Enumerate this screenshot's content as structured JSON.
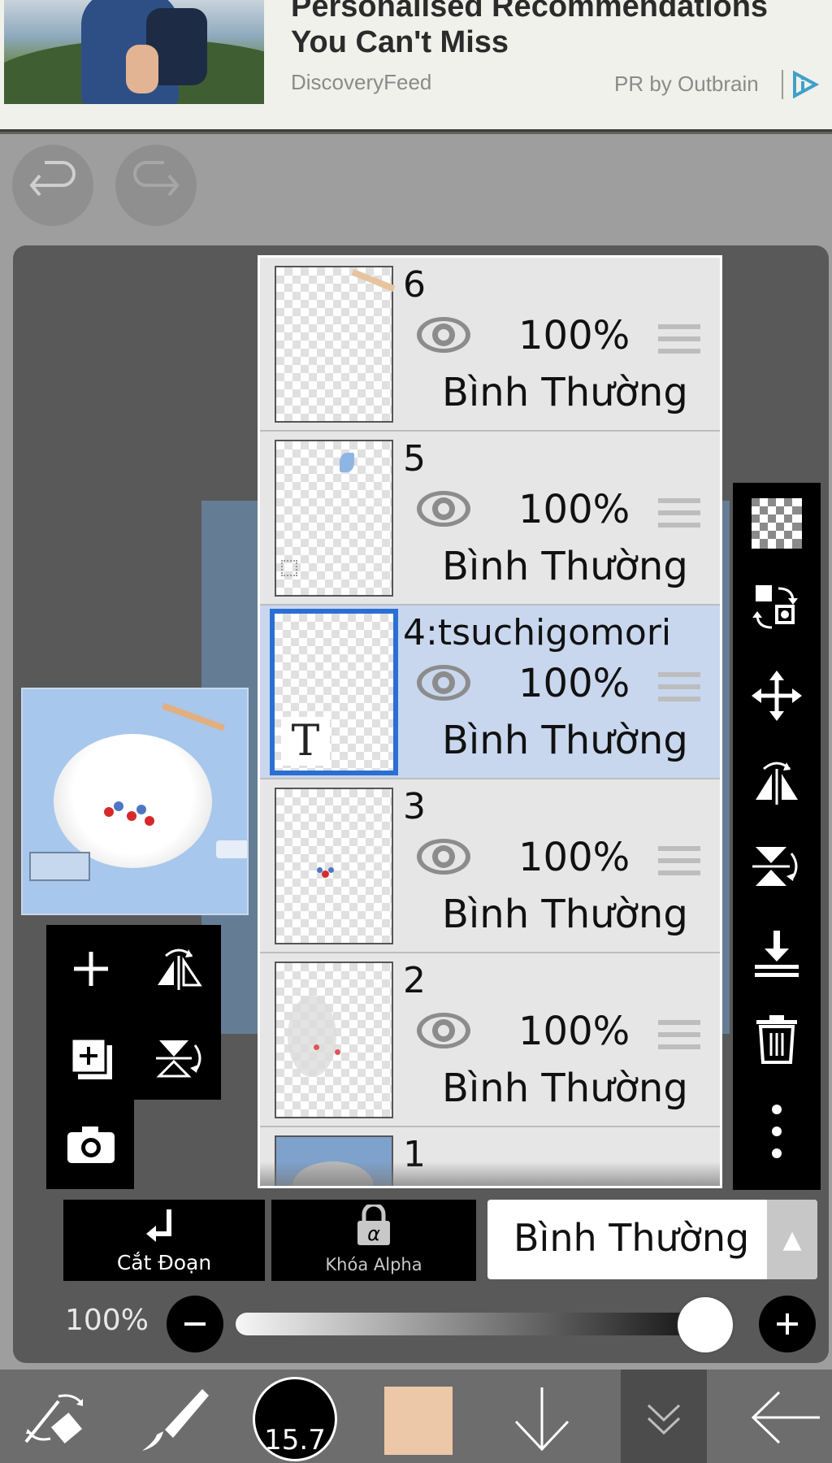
{
  "ad": {
    "title": "Personalised Recommendations You Can't Miss",
    "source": "DiscoveryFeed",
    "sponsor": "PR by Outbrain"
  },
  "layers": [
    {
      "name": "6",
      "opacity": "100%",
      "blend": "Bình Thường",
      "selected": false
    },
    {
      "name": "5",
      "opacity": "100%",
      "blend": "Bình Thường",
      "selected": false
    },
    {
      "name": "4:tsuchigomori",
      "opacity": "100%",
      "blend": "Bình Thường",
      "selected": true,
      "badge": "T"
    },
    {
      "name": "3",
      "opacity": "100%",
      "blend": "Bình Thường",
      "selected": false
    },
    {
      "name": "2",
      "opacity": "100%",
      "blend": "Bình Thường",
      "selected": false
    },
    {
      "name": "1"
    }
  ],
  "actions": {
    "clip_label": "Cắt Đoạn",
    "alpha_icon_text": "α",
    "alpha_label": "Khóa Alpha",
    "blend_mode": "Bình Thường"
  },
  "opacity": {
    "label": "100%",
    "value": 1.0
  },
  "brush": {
    "size": "15.7"
  },
  "colors": {
    "accent": "#2a6fd3",
    "selected_row": "#c8d7ee",
    "current_color": "#ecc8a8"
  }
}
